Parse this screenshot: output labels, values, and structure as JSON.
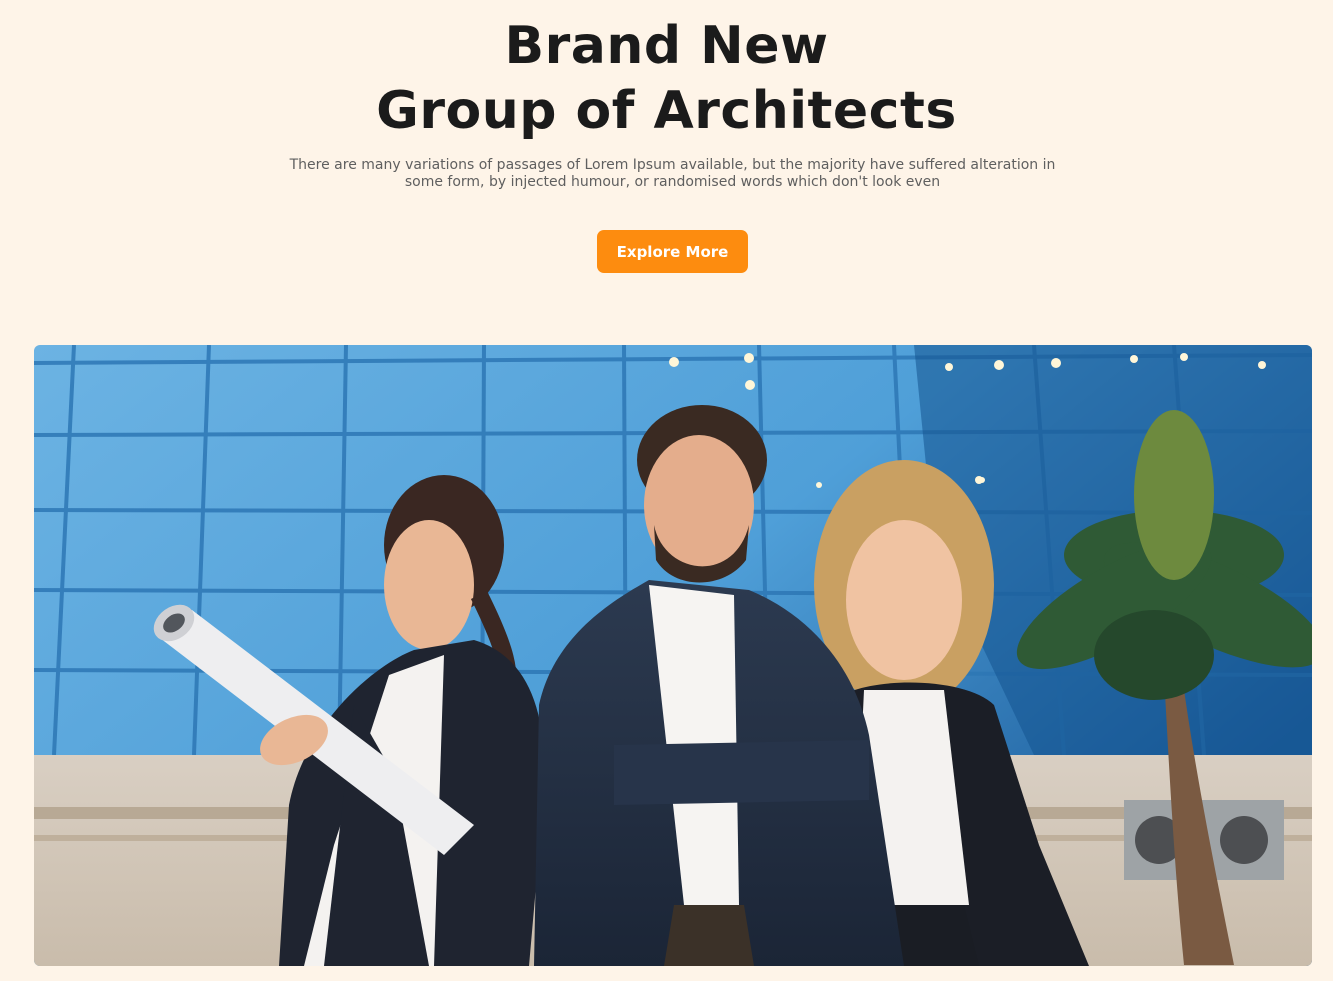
{
  "hero": {
    "title_line1": "Brand New",
    "title_line2": "Group of Architects",
    "subtitle": "There are many variations of passages of Lorem Ipsum available, but the majority have suffered alteration in some form, by injected humour, or randomised words which don't look even",
    "cta_label": "Explore More"
  },
  "colors": {
    "background": "#fef4e8",
    "accent": "#fd8c0f",
    "title": "#1b1b1b",
    "subtitle": "#5f5f5f"
  },
  "image": {
    "subject": "three-architects-in-front-of-glass-building"
  }
}
